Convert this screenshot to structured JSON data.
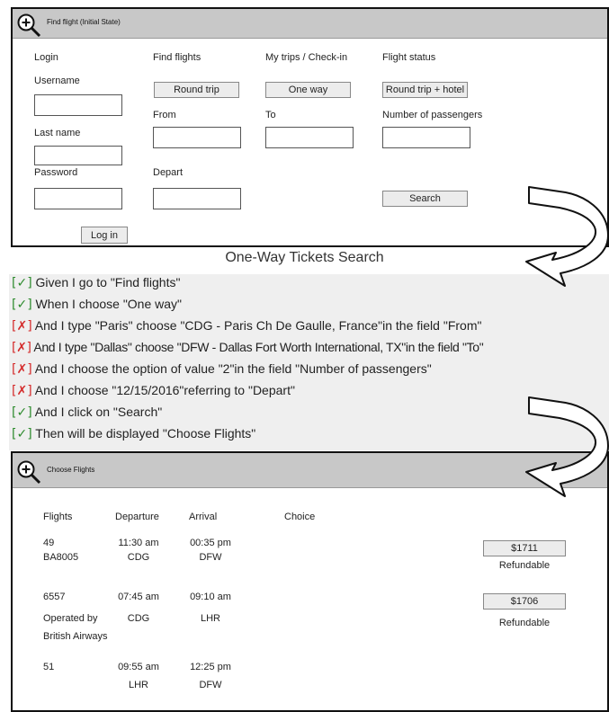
{
  "top_panel": {
    "title": "Find flight  (Initial State)",
    "login_header": "Login",
    "find_flights_header": "Find flights",
    "my_trips_header": "My trips / Check-in",
    "flight_status_header": "Flight status",
    "username_label": "Username",
    "last_name_label": "Last name",
    "password_label": "Password",
    "login_button": "Log in",
    "round_trip_button": "Round trip",
    "one_way_button": "One way",
    "round_trip_hotel_button": "Round trip + hotel",
    "from_label": "From",
    "to_label": "To",
    "passengers_label": "Number of passengers",
    "depart_label": "Depart",
    "search_button": "Search"
  },
  "scenario": {
    "heading": "One-Way Tickets Search",
    "steps": [
      {
        "status": "pass",
        "mark": "[✓]",
        "text": " Given I go to \"Find flights\""
      },
      {
        "status": "pass",
        "mark": "[✓]",
        "text": " When I choose \"One way\""
      },
      {
        "status": "fail",
        "mark": "[✗]",
        "text": " And I type \"Paris\" choose \"CDG - Paris Ch De Gaulle, France\"in the field \"From\""
      },
      {
        "status": "fail",
        "mark": "[✗]",
        "text": " And I type \"Dallas\" choose \"DFW - Dallas Fort Worth International, TX\"in the field \"To\""
      },
      {
        "status": "fail",
        "mark": "[✗]",
        "text": " And I choose the option of value \"2\"in the field \"Number of passengers\""
      },
      {
        "status": "fail",
        "mark": "[✗]",
        "text": " And I choose \"12/15/2016\"referring to \"Depart\""
      },
      {
        "status": "pass",
        "mark": "[✓]",
        "text": " And I click on \"Search\""
      },
      {
        "status": "pass",
        "mark": "[✓]",
        "text": " Then will be displayed \"Choose Flights\""
      }
    ],
    "colors": {
      "pass": "#2e8b2e",
      "fail": "#d42a2a"
    }
  },
  "bottom_panel": {
    "title": "Choose Flights",
    "headers": {
      "flights": "Flights",
      "departure": "Departure",
      "arrival": "Arrival",
      "choice": "Choice"
    },
    "rows": [
      {
        "flight": "49",
        "flight2": "BA8005",
        "dep_time": "11:30 am",
        "dep_code": "CDG",
        "arr_time": "00:35 pm",
        "arr_code": "DFW",
        "price": "$1711",
        "note": "Refundable"
      },
      {
        "flight": "6557",
        "flight2": "Operated by",
        "flight3": "British Airways",
        "dep_time": "07:45 am",
        "dep_code": "CDG",
        "arr_time": "09:10 am",
        "arr_code": "LHR",
        "price": "$1706",
        "note": "Refundable"
      },
      {
        "flight": "51",
        "dep_time": "09:55 am",
        "dep_code": "LHR",
        "arr_time": "12:25 pm",
        "arr_code": "DFW"
      }
    ]
  }
}
